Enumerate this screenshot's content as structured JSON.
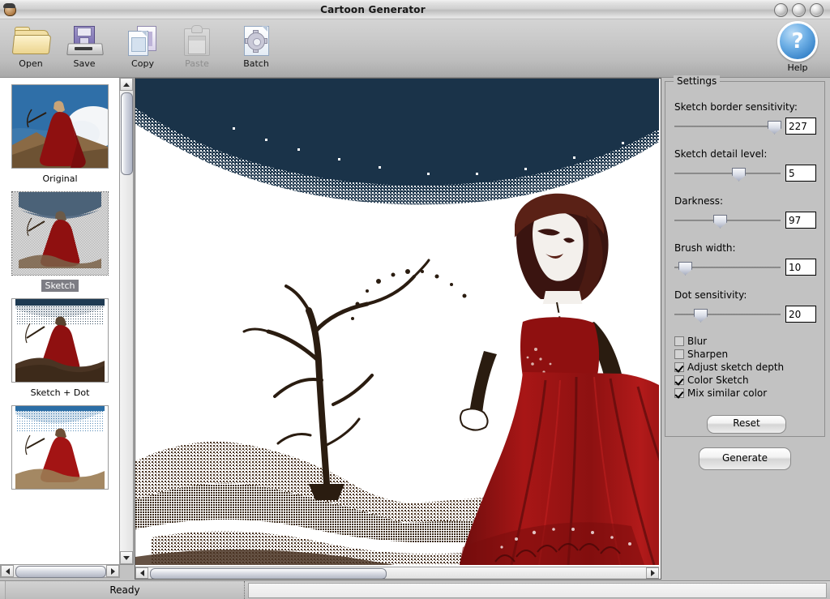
{
  "window": {
    "title": "Cartoon Generator",
    "app_icon": "app-face-icon",
    "buttons": [
      "minimize",
      "maximize",
      "close"
    ]
  },
  "toolbar": {
    "items": [
      {
        "label": "Open",
        "icon": "folder-open-icon",
        "enabled": true
      },
      {
        "label": "Save",
        "icon": "floppy-save-icon",
        "enabled": true
      },
      {
        "label": "Copy",
        "icon": "copy-pages-icon",
        "enabled": true
      },
      {
        "label": "Paste",
        "icon": "clipboard-paste-icon",
        "enabled": false
      },
      {
        "label": "Batch",
        "icon": "document-gear-icon",
        "enabled": true
      }
    ],
    "help": {
      "label": "Help",
      "icon": "question-circle-icon",
      "glyph": "?"
    }
  },
  "thumbnails": {
    "items": [
      {
        "label": "Original",
        "selected": false
      },
      {
        "label": "Sketch",
        "selected": true
      },
      {
        "label": "Sketch + Dot",
        "selected": false
      },
      {
        "label": "",
        "selected": false
      }
    ]
  },
  "settings": {
    "legend": "Settings",
    "sliders": [
      {
        "label": "Sketch border sensitivity:",
        "value": "227",
        "pos_pct": 88
      },
      {
        "label": "Sketch detail level:",
        "value": "5",
        "pos_pct": 55
      },
      {
        "label": "Darkness:",
        "value": "97",
        "pos_pct": 37
      },
      {
        "label": "Brush width:",
        "value": "10",
        "pos_pct": 5
      },
      {
        "label": "Dot sensitivity:",
        "value": "20",
        "pos_pct": 19
      }
    ],
    "checkboxes": [
      {
        "label": "Blur",
        "checked": false
      },
      {
        "label": "Sharpen",
        "checked": false
      },
      {
        "label": "Adjust sketch depth",
        "checked": true
      },
      {
        "label": "Color Sketch",
        "checked": true
      },
      {
        "label": "Mix similar color",
        "checked": true
      }
    ],
    "reset_label": "Reset"
  },
  "actions": {
    "generate_label": "Generate"
  },
  "statusbar": {
    "ready_text": "Ready",
    "progress_text": ""
  },
  "colors": {
    "sky": "#1a3349",
    "dress": "#8f1010",
    "dress_dark": "#5c0b0b",
    "ground": "#4a3423",
    "paper": "#ffffff",
    "chrome": "#c2c2c2",
    "selection": "#7d7d84",
    "help_blue": "#2f7cc4"
  },
  "scrollbars": {
    "left_vertical": {
      "thumb_top_pct": 3,
      "thumb_size_pct": 17
    },
    "left_horizontal": {
      "thumb_left_pct": 8,
      "thumb_size_pct": 78
    },
    "canvas_horizontal": {
      "thumb_left_pct": 3,
      "thumb_size_pct": 47
    }
  }
}
